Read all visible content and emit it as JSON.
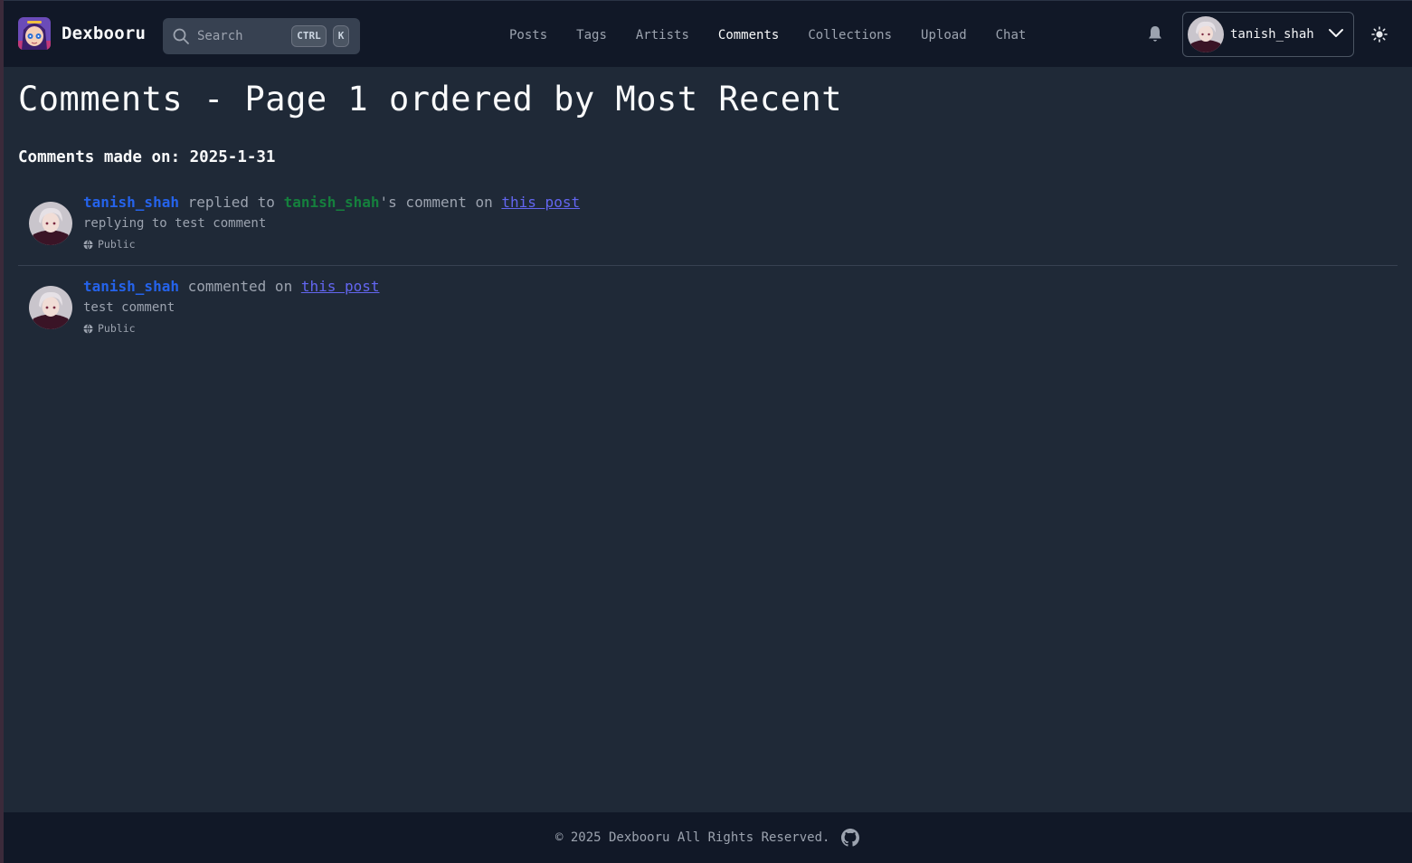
{
  "brand": {
    "name": "Dexbooru",
    "logo_icon": "anime-girl-logo"
  },
  "search": {
    "placeholder": "Search",
    "shortcut_ctrl": "CTRL",
    "shortcut_key": "K"
  },
  "nav": {
    "active": "Comments",
    "items": [
      {
        "label": "Posts"
      },
      {
        "label": "Tags"
      },
      {
        "label": "Artists"
      },
      {
        "label": "Comments"
      },
      {
        "label": "Collections"
      },
      {
        "label": "Upload"
      },
      {
        "label": "Chat"
      }
    ]
  },
  "user": {
    "name": "tanish_shah"
  },
  "colors": {
    "background": "#1f2937",
    "header": "#111827",
    "username_link": "#2563eb",
    "replied_user": "#15803d",
    "post_link": "#6366f1"
  },
  "main": {
    "title": "Comments - Page 1 ordered by Most Recent",
    "date_heading": "Comments made on: 2025-1-31",
    "comments": [
      {
        "author": "tanish_shah",
        "action": " replied to ",
        "target_user": "tanish_shah",
        "target_suffix": "'s comment on ",
        "link": "this post",
        "text": "replying to test comment",
        "visibility": "Public"
      },
      {
        "author": "tanish_shah",
        "action": " commented on ",
        "link": "this post",
        "text": "test comment",
        "visibility": "Public"
      }
    ]
  },
  "footer": {
    "text": "© 2025 Dexbooru All Rights Reserved.",
    "icon": "github-icon"
  }
}
